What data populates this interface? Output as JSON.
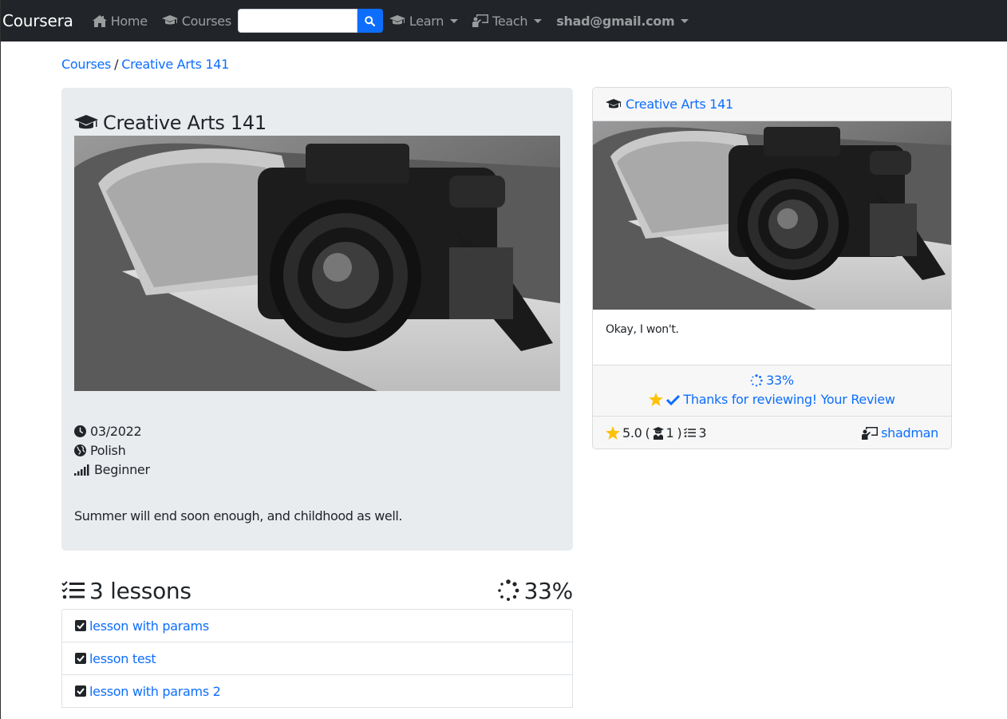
{
  "navbar": {
    "brand": "Coursera",
    "home_label": "Home",
    "courses_label": "Courses",
    "search_placeholder": "",
    "learn_label": "Learn",
    "teach_label": "Teach",
    "user_label": "shad@gmail.com"
  },
  "breadcrumb": {
    "root": "Courses",
    "separator": "/",
    "current": "Creative Arts 141"
  },
  "course": {
    "title": "Creative Arts 141",
    "date": "03/2022",
    "language": "Polish",
    "level": "Beginner",
    "description": "Summer will end soon enough, and childhood as well."
  },
  "lessons": {
    "count_label": "3 lessons",
    "progress_label": "33%",
    "items": [
      {
        "label": "lesson with params"
      },
      {
        "label": "lesson test"
      },
      {
        "label": "lesson with params 2"
      }
    ]
  },
  "side_card": {
    "title": "Creative Arts 141",
    "body": "Okay, I won't.",
    "progress": "33%",
    "review_text": "Thanks for reviewing! Your Review",
    "rating": "5.0",
    "open_paren": "(",
    "students": "1",
    "close_paren": ")",
    "lesson_count": "3",
    "author": "shadman"
  },
  "colors": {
    "navbar_bg": "#212529",
    "link": "#0d6efd",
    "card_bg": "#e9ecef",
    "star": "#ffc107"
  }
}
